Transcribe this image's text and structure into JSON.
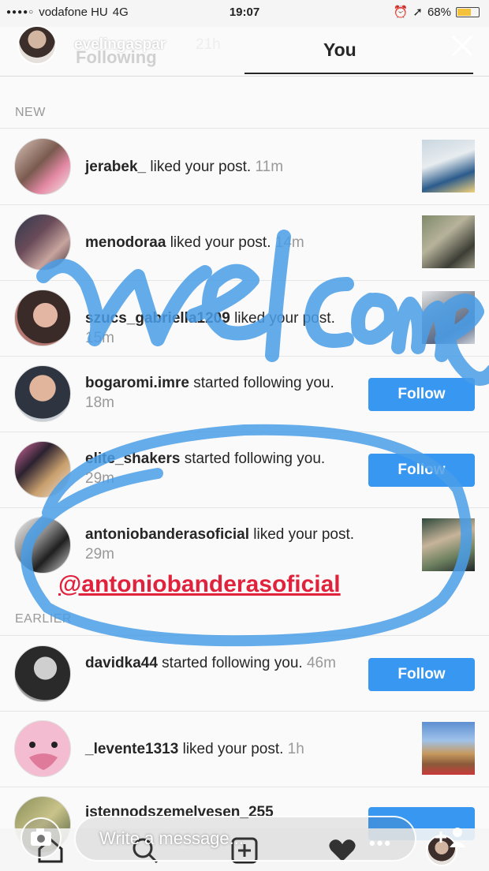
{
  "status_bar": {
    "carrier": "vodafone HU",
    "network": "4G",
    "time": "19:07",
    "battery": "68%",
    "battery_fraction": 0.68,
    "icons": [
      "signal-dots-icon",
      "alarm-icon",
      "location-arrow-icon",
      "battery-icon"
    ]
  },
  "story": {
    "username": "evelingaspar",
    "time_ago": "21h",
    "faded_tab": "Following",
    "active_tab": "You",
    "close_icon": "close-icon"
  },
  "sections": {
    "new": "NEW",
    "earlier": "EARLIER"
  },
  "notifications": [
    {
      "user": "jerabek_",
      "action": " liked your post. ",
      "time": "11m",
      "kind": "thumb"
    },
    {
      "user": "menodoraa",
      "action": " liked your post. ",
      "time": "14m",
      "kind": "thumb"
    },
    {
      "user": "szucs_gabriella1209",
      "action": " liked your post. ",
      "time": "15m",
      "kind": "thumb"
    },
    {
      "user": "bogaromi.imre",
      "action": " started following you. ",
      "time": "18m",
      "kind": "follow",
      "button": "Follow"
    },
    {
      "user": "elite_shakers",
      "action": " started following you. ",
      "time": "29m",
      "kind": "follow",
      "button": "Follow"
    },
    {
      "user": "antoniobanderasoficial",
      "action": " liked your post. ",
      "time": "29m",
      "kind": "thumb"
    },
    {
      "user": "davidka44",
      "action": " started following you. ",
      "time": "46m",
      "kind": "follow",
      "button": "Follow"
    },
    {
      "user": "_levente1313",
      "action": " liked your post. ",
      "time": "1h",
      "kind": "thumb"
    },
    {
      "user": "istennodszemelvesen_255",
      "action": "",
      "time": "",
      "kind": "follow",
      "button": ""
    }
  ],
  "overlay": {
    "mention": "@antoniobanderasoficial",
    "handwriting": "welcome",
    "colors": {
      "ink": "#4a9ee8",
      "mention": "#e0223c"
    }
  },
  "composer": {
    "placeholder": "Write a message...",
    "more_label": "•••"
  },
  "tabbar_icons": [
    "home-icon",
    "search-icon",
    "add-post-icon",
    "heart-icon",
    "profile-avatar-icon"
  ],
  "colors": {
    "follow_button": "#3897f0",
    "text": "#262626",
    "muted": "#999999"
  }
}
